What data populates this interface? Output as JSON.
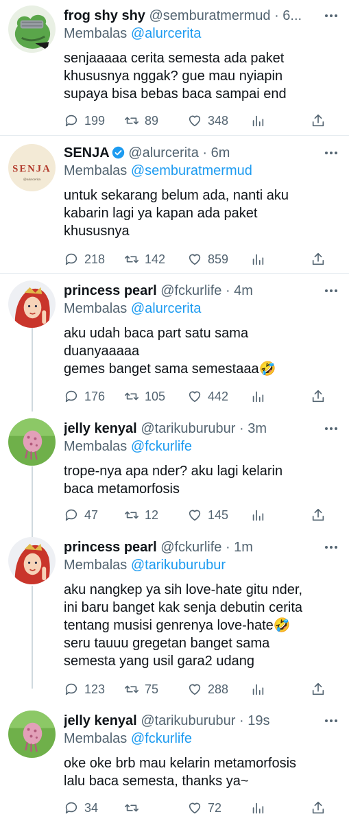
{
  "tweets": [
    {
      "name": "frog shy shy",
      "handle": "@semburatmermud",
      "time": "· 6...",
      "reply_prefix": "Membalas",
      "reply_to": "@alurcerita",
      "text": "senjaaaaa cerita semesta ada paket\nkhususnya nggak? gue mau nyiapin\nsupaya bisa bebas baca sampai end",
      "replies": "199",
      "retweets": "89",
      "likes": "348"
    },
    {
      "name": "SENJA",
      "handle": "@alurcerita",
      "time": "· 6m",
      "verified": true,
      "reply_prefix": "Membalas",
      "reply_to": "@semburatmermud",
      "text": "untuk sekarang belum ada, nanti aku\nkabarin lagi ya kapan ada paket\nkhususnya",
      "replies": "218",
      "retweets": "142",
      "likes": "859",
      "avatar_text": "SENJA",
      "avatar_subtext": "@alurcerita"
    },
    {
      "name": "princess pearl",
      "handle": "@fckurlife",
      "time": "· 4m",
      "reply_prefix": "Membalas",
      "reply_to": "@alurcerita",
      "text": "aku udah baca part satu sama\nduanyaaaaa\ngemes banget sama semestaaa🤣",
      "replies": "176",
      "retweets": "105",
      "likes": "442"
    },
    {
      "name": "jelly kenyal",
      "handle": "@tarikuburubur",
      "time": "· 3m",
      "reply_prefix": "Membalas",
      "reply_to": "@fckurlife",
      "text": "trope-nya apa nder? aku lagi kelarin\nbaca metamorfosis",
      "replies": "47",
      "retweets": "12",
      "likes": "145"
    },
    {
      "name": "princess pearl",
      "handle": "@fckurlife",
      "time": "· 1m",
      "reply_prefix": "Membalas",
      "reply_to": "@tarikuburubur",
      "text": "aku nangkep ya sih love-hate gitu nder,\nini baru banget kak senja debutin cerita\ntentang musisi genrenya love-hate🤣\nseru tauuu gregetan banget sama\nsemesta yang usil gara2 udang",
      "replies": "123",
      "retweets": "75",
      "likes": "288"
    },
    {
      "name": "jelly kenyal",
      "handle": "@tarikuburubur",
      "time": "· 19s",
      "reply_prefix": "Membalas",
      "reply_to": "@fckurlife",
      "text": "oke oke brb mau kelarin metamorfosis\nlalu baca semesta, thanks ya~",
      "replies": "34",
      "retweets": "",
      "likes": "72"
    }
  ],
  "colors": {
    "link": "#1d9bf0",
    "muted": "#536471",
    "verified": "#1d9bf0",
    "thread_line": "#cfd9de"
  }
}
